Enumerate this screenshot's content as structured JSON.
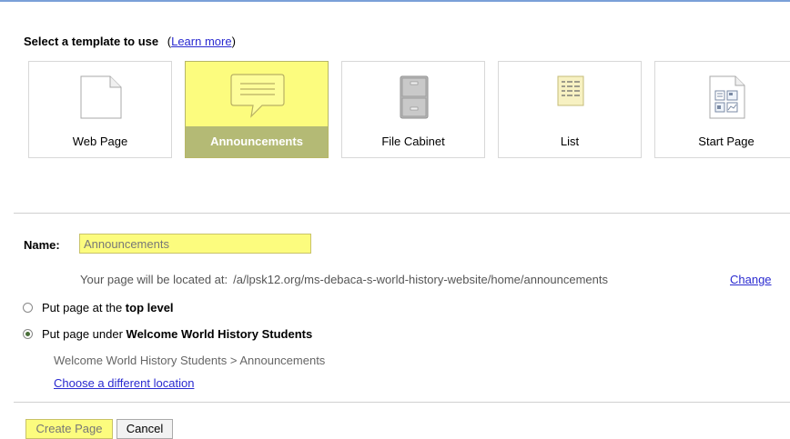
{
  "heading": {
    "title": "Select a template to use",
    "learn_open": "(",
    "learn_link": "Learn more",
    "learn_close": ")"
  },
  "templates": [
    {
      "label": "Web Page",
      "icon": "web-page-icon",
      "selected": false
    },
    {
      "label": "Announcements",
      "icon": "announcements-icon",
      "selected": true
    },
    {
      "label": "File Cabinet",
      "icon": "file-cabinet-icon",
      "selected": false
    },
    {
      "label": "List",
      "icon": "list-icon",
      "selected": false
    },
    {
      "label": "Start Page",
      "icon": "start-page-icon",
      "selected": false
    }
  ],
  "name": {
    "label": "Name:",
    "value": "Announcements"
  },
  "location": {
    "prefix": "Your page will be located at:",
    "path": "/a/lpsk12.org/ms-debaca-s-world-history-website/home/announcements",
    "change_label": "Change"
  },
  "placement": {
    "top_level_prefix": "Put page at the ",
    "top_level_bold": "top level",
    "under_prefix": "Put page under ",
    "under_bold": "Welcome World History Students",
    "breadcrumb": "Welcome World History Students > Announcements",
    "choose_label": "Choose a different location"
  },
  "buttons": {
    "create": "Create Page",
    "cancel": "Cancel"
  },
  "colors": {
    "highlight": "#fcfc7e",
    "selected_label_bg": "#b4ba75",
    "link": "#2a2ad0"
  }
}
